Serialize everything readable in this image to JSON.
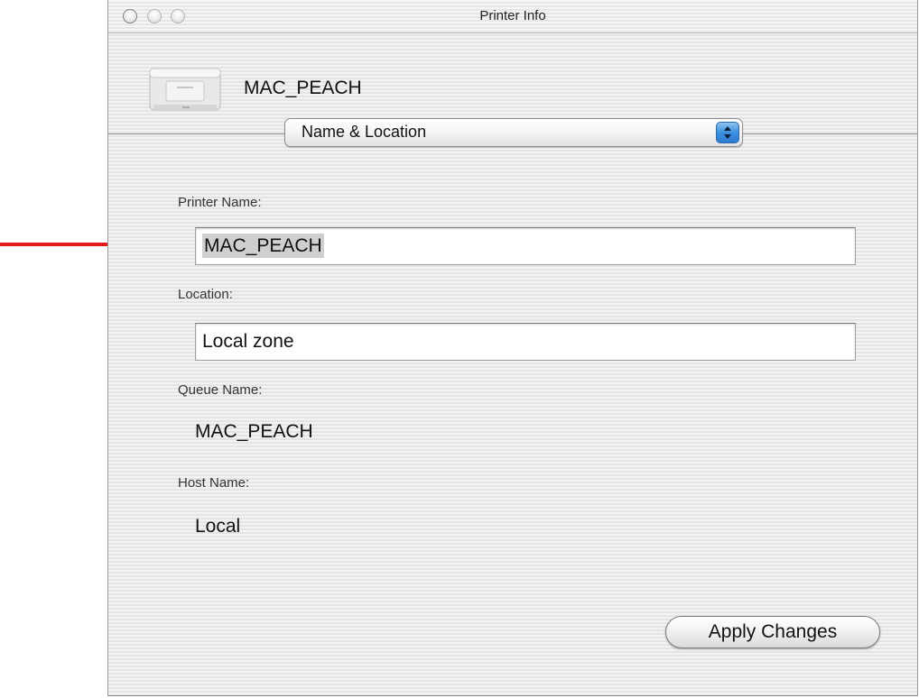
{
  "window": {
    "title": "Printer Info"
  },
  "header": {
    "printer_name": "MAC_PEACH",
    "popup_selected": "Name & Location",
    "printer_icon": "printer-icon"
  },
  "form": {
    "printer_name_label": "Printer Name:",
    "printer_name_value": "MAC_PEACH",
    "location_label": "Location:",
    "location_value": "Local zone",
    "queue_name_label": "Queue Name:",
    "queue_name_value": "MAC_PEACH",
    "host_name_label": "Host Name:",
    "host_name_value": "Local"
  },
  "buttons": {
    "apply_label": "Apply Changes"
  },
  "annotation": {
    "arrow_color": "#e41b1b"
  }
}
